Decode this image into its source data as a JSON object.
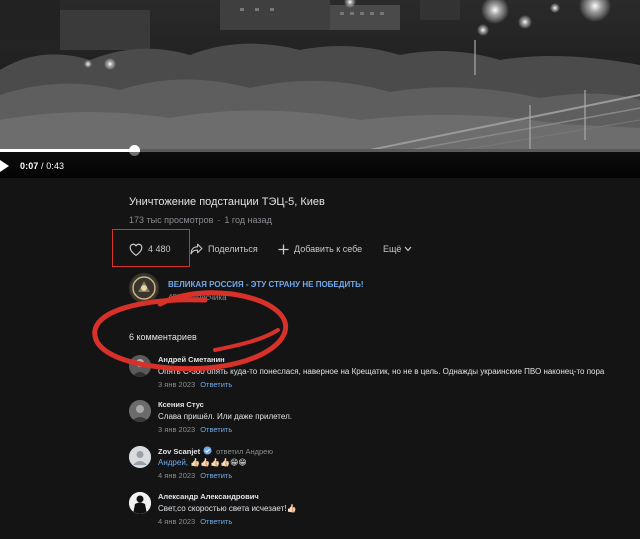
{
  "player": {
    "current_time": "0:07",
    "duration_sep": " / ",
    "duration": "0:43",
    "progress": 0.21
  },
  "video": {
    "title": "Уничтожение подстанции ТЭЦ-5, Киев",
    "views": "173 тыс просмотров",
    "date": "1 год назад"
  },
  "actions": {
    "likes": "4 480",
    "share": "Поделиться",
    "add": "Добавить к себе",
    "more": "Ещё"
  },
  "channel": {
    "name": "ВЕЛИКАЯ РОССИЯ - ЭТУ СТРАНУ НЕ ПОБЕДИТЬ!",
    "subs": "48К подписчика"
  },
  "comments": {
    "count_label": "6 комментариев",
    "items": [
      {
        "author": "Андрей Сметанин",
        "text": "Опять С-300 опять куда-то понеслася, наверное на Крещатик, но не в цель. Однажды украинские ПВО наконец-то пора",
        "date": "3 янв 2023",
        "reply": "Ответить"
      },
      {
        "author": "Ксения Стус",
        "text": "Слава пришёл. Или даже прилетел.",
        "date": "3 янв 2023",
        "reply": "Ответить"
      },
      {
        "author": "Zov Scanjet",
        "replied_label": "ответил Андрею",
        "mention": "Андрей,",
        "text": "👍🏻👍🏻👍🏻👍🏻😁😁",
        "date": "4 янв 2023",
        "reply": "Ответить"
      },
      {
        "author": "Александр Александрович",
        "text": "Свет,со скоростью света исчезает!👍🏻",
        "date": "4 янв 2023",
        "reply": "Ответить"
      }
    ]
  },
  "colors": {
    "background": "#141414",
    "link": "#71aaeb",
    "annotation": "#d8312a"
  }
}
